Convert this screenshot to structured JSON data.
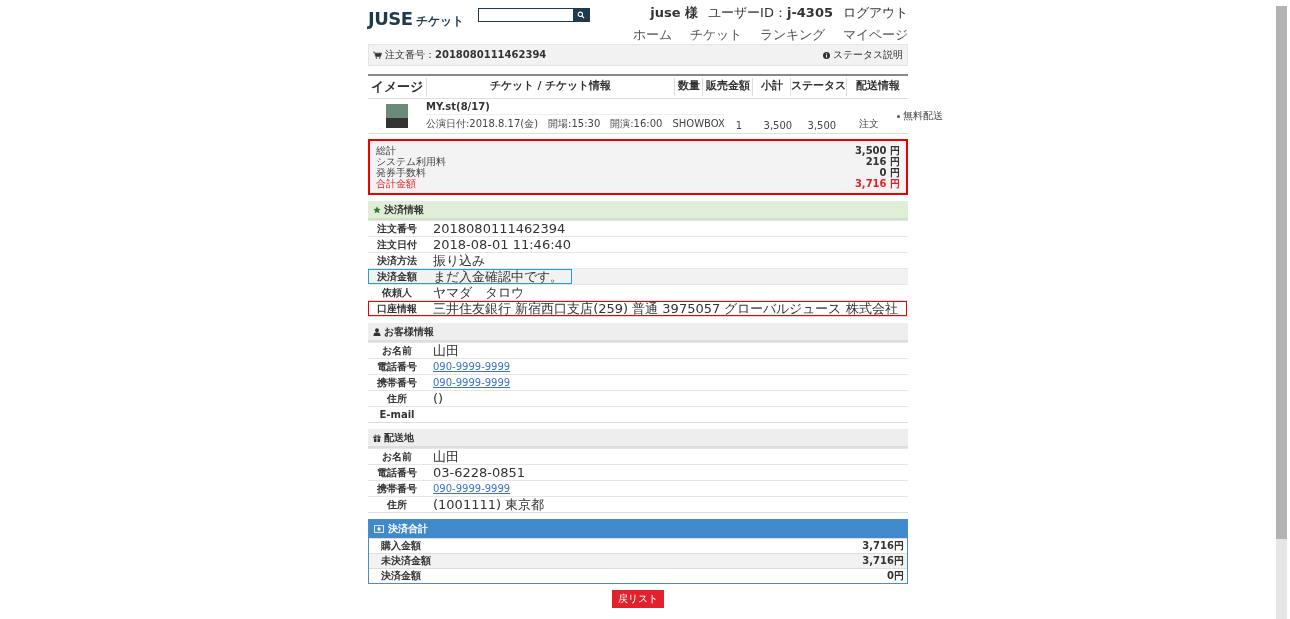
{
  "header": {
    "logo_main": "JUSE",
    "logo_sub": "チケット",
    "user": "juse 様",
    "user_id_label": "ユーザーID：",
    "user_id": "j-4305",
    "logout": "ログアウト",
    "nav": [
      "ホーム",
      "チケット",
      "ランキング",
      "マイページ"
    ]
  },
  "order": {
    "label": "注文番号：",
    "number": "2018080111462394",
    "status_help": "ステータス説明"
  },
  "table": {
    "columns": [
      "イメージ",
      "チケット / チケット情報",
      "数量",
      "販売金額",
      "小計",
      "ステータス",
      "配送情報"
    ],
    "rows": [
      {
        "title": "MY.st(8/17)",
        "info": "公演日付:2018.8.17(金)　開場:15:30　開演:16:00　SHOWBOX",
        "qty": "1",
        "price": "3,500",
        "subtotal": "3,500",
        "status": "注文",
        "delivery": "無料配送"
      }
    ]
  },
  "summary": {
    "color": "#ee0000",
    "lines": [
      {
        "label": "総計",
        "value": "3,500 円",
        "emphasis": false
      },
      {
        "label": "システム利用料",
        "value": "216 円",
        "emphasis": false
      },
      {
        "label": "発券手数料",
        "value": "0 円",
        "emphasis": false
      },
      {
        "label": "合計金額",
        "value": "3,716 円",
        "emphasis": true
      }
    ]
  },
  "sections": [
    {
      "kind": "star",
      "title": "決済情報",
      "rows": [
        {
          "label": "注文番号",
          "value": "2018080111462394",
          "link": false,
          "shaded": false
        },
        {
          "label": "注文日付",
          "value": "2018-08-01 11:46:40",
          "link": false,
          "shaded": false
        },
        {
          "label": "決済方法",
          "value": "振り込み",
          "link": false,
          "shaded": false
        },
        {
          "label": "決済金額",
          "value": "まだ入金確認中です。",
          "link": false,
          "shaded": true,
          "color": "#1ea0dc"
        },
        {
          "label": "依頼人",
          "value": "ヤマダ　タロウ",
          "link": false,
          "shaded": false
        },
        {
          "label": "口座情報",
          "value": "三井住友銀行 新宿西口支店(259) 普通 3975057 グローバルジュース 株式会社",
          "link": false,
          "shaded": false,
          "color": "#ee0000"
        }
      ]
    },
    {
      "kind": "person",
      "title": "お客様情報",
      "rows": [
        {
          "label": "お名前",
          "value": "山田",
          "link": false,
          "shaded": false
        },
        {
          "label": "電話番号",
          "value": "090-9999-9999",
          "link": true,
          "shaded": false
        },
        {
          "label": "携帯番号",
          "value": "090-9999-9999",
          "link": true,
          "shaded": false
        },
        {
          "label": "住所",
          "value": "()",
          "link": false,
          "shaded": false
        },
        {
          "label": "E-mail",
          "shaded": false
        }
      ]
    },
    {
      "kind": "gift",
      "title": "配送地",
      "rows": [
        {
          "label": "お名前",
          "value": "山田",
          "link": false,
          "shaded": false
        },
        {
          "label": "電話番号",
          "value": "03-6228-0851",
          "link": false,
          "shaded": false
        },
        {
          "label": "携帯番号",
          "value": "090-9999-9999",
          "link": true,
          "shaded": false
        },
        {
          "label": "住所",
          "value": "(1001111) 東京都",
          "link": false,
          "shaded": false
        }
      ]
    }
  ],
  "totals": {
    "title": "決済合計",
    "rows": [
      {
        "label": "購入金額",
        "value": "3,716円",
        "shaded": false
      },
      {
        "label": "未決済金額",
        "value": "3,716円",
        "shaded": true
      },
      {
        "label": "決済金額",
        "value": "0円",
        "shaded": false
      }
    ]
  },
  "back_button": "戻リスト"
}
